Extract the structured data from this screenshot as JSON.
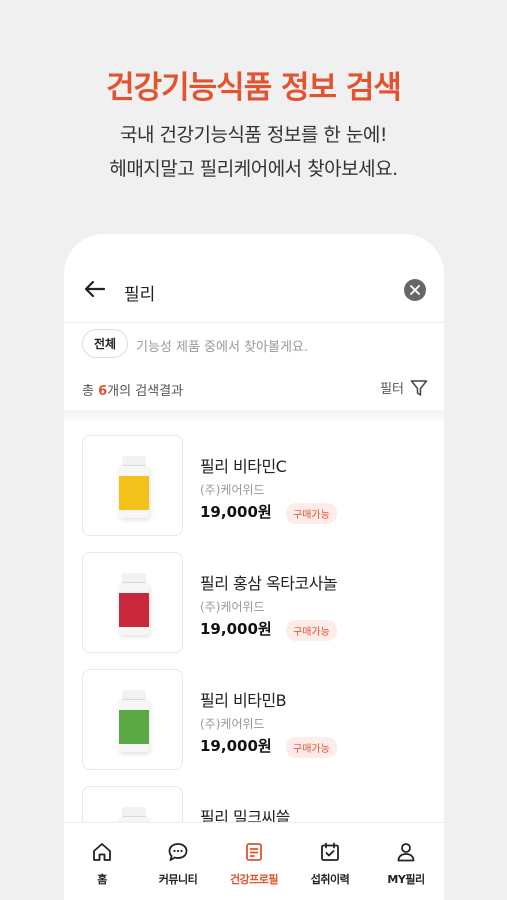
{
  "hero": {
    "title": "건강기능식품 정보 검색",
    "subtitle_line1": "국내 건강기능식품 정보를 한 눈에!",
    "subtitle_line2": "헤매지말고 필리케어에서 찾아보세요."
  },
  "search": {
    "query": "필리"
  },
  "filters": {
    "chip_all": "전체",
    "hint": "기능성 제품 중에서 찾아볼게요."
  },
  "results": {
    "prefix": "총 ",
    "count": "6",
    "suffix": "개의 검색결과",
    "filter_label": "필터"
  },
  "products": [
    {
      "name": "필리 비타민C",
      "maker": "(주)케어위드",
      "price": "19,000원",
      "badge": "구매가능",
      "label_color": "#f2c21b"
    },
    {
      "name": "필리 홍삼 옥타코사놀",
      "maker": "(주)케어위드",
      "price": "19,000원",
      "badge": "구매가능",
      "label_color": "#c8273c"
    },
    {
      "name": "필리 비타민B",
      "maker": "(주)케어위드",
      "price": "19,000원",
      "badge": "구매가능",
      "label_color": "#5aa843"
    },
    {
      "name": "필리 밀크씨쓸",
      "maker": "",
      "price": "",
      "badge": "",
      "label_color": "#bbbbbb"
    }
  ],
  "tabs": [
    {
      "label": "홈",
      "icon": "home-icon"
    },
    {
      "label": "커뮤니티",
      "icon": "chat-icon"
    },
    {
      "label": "건강프로필",
      "icon": "profile-doc-icon",
      "active": true
    },
    {
      "label": "섭취이력",
      "icon": "calendar-check-icon"
    },
    {
      "label": "MY필리",
      "icon": "person-icon"
    }
  ],
  "colors": {
    "accent": "#e2532f",
    "background": "#f0f0f0"
  }
}
